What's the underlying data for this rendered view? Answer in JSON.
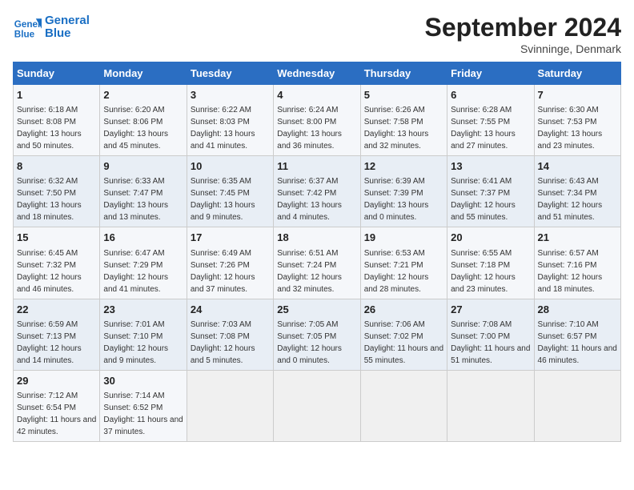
{
  "header": {
    "logo_line1": "General",
    "logo_line2": "Blue",
    "month": "September 2024",
    "location": "Svinninge, Denmark"
  },
  "days_of_week": [
    "Sunday",
    "Monday",
    "Tuesday",
    "Wednesday",
    "Thursday",
    "Friday",
    "Saturday"
  ],
  "weeks": [
    [
      {
        "day": 1,
        "sunrise": "6:18 AM",
        "sunset": "8:08 PM",
        "daylight": "13 hours and 50 minutes."
      },
      {
        "day": 2,
        "sunrise": "6:20 AM",
        "sunset": "8:06 PM",
        "daylight": "13 hours and 45 minutes."
      },
      {
        "day": 3,
        "sunrise": "6:22 AM",
        "sunset": "8:03 PM",
        "daylight": "13 hours and 41 minutes."
      },
      {
        "day": 4,
        "sunrise": "6:24 AM",
        "sunset": "8:00 PM",
        "daylight": "13 hours and 36 minutes."
      },
      {
        "day": 5,
        "sunrise": "6:26 AM",
        "sunset": "7:58 PM",
        "daylight": "13 hours and 32 minutes."
      },
      {
        "day": 6,
        "sunrise": "6:28 AM",
        "sunset": "7:55 PM",
        "daylight": "13 hours and 27 minutes."
      },
      {
        "day": 7,
        "sunrise": "6:30 AM",
        "sunset": "7:53 PM",
        "daylight": "13 hours and 23 minutes."
      }
    ],
    [
      {
        "day": 8,
        "sunrise": "6:32 AM",
        "sunset": "7:50 PM",
        "daylight": "13 hours and 18 minutes."
      },
      {
        "day": 9,
        "sunrise": "6:33 AM",
        "sunset": "7:47 PM",
        "daylight": "13 hours and 13 minutes."
      },
      {
        "day": 10,
        "sunrise": "6:35 AM",
        "sunset": "7:45 PM",
        "daylight": "13 hours and 9 minutes."
      },
      {
        "day": 11,
        "sunrise": "6:37 AM",
        "sunset": "7:42 PM",
        "daylight": "13 hours and 4 minutes."
      },
      {
        "day": 12,
        "sunrise": "6:39 AM",
        "sunset": "7:39 PM",
        "daylight": "13 hours and 0 minutes."
      },
      {
        "day": 13,
        "sunrise": "6:41 AM",
        "sunset": "7:37 PM",
        "daylight": "12 hours and 55 minutes."
      },
      {
        "day": 14,
        "sunrise": "6:43 AM",
        "sunset": "7:34 PM",
        "daylight": "12 hours and 51 minutes."
      }
    ],
    [
      {
        "day": 15,
        "sunrise": "6:45 AM",
        "sunset": "7:32 PM",
        "daylight": "12 hours and 46 minutes."
      },
      {
        "day": 16,
        "sunrise": "6:47 AM",
        "sunset": "7:29 PM",
        "daylight": "12 hours and 41 minutes."
      },
      {
        "day": 17,
        "sunrise": "6:49 AM",
        "sunset": "7:26 PM",
        "daylight": "12 hours and 37 minutes."
      },
      {
        "day": 18,
        "sunrise": "6:51 AM",
        "sunset": "7:24 PM",
        "daylight": "12 hours and 32 minutes."
      },
      {
        "day": 19,
        "sunrise": "6:53 AM",
        "sunset": "7:21 PM",
        "daylight": "12 hours and 28 minutes."
      },
      {
        "day": 20,
        "sunrise": "6:55 AM",
        "sunset": "7:18 PM",
        "daylight": "12 hours and 23 minutes."
      },
      {
        "day": 21,
        "sunrise": "6:57 AM",
        "sunset": "7:16 PM",
        "daylight": "12 hours and 18 minutes."
      }
    ],
    [
      {
        "day": 22,
        "sunrise": "6:59 AM",
        "sunset": "7:13 PM",
        "daylight": "12 hours and 14 minutes."
      },
      {
        "day": 23,
        "sunrise": "7:01 AM",
        "sunset": "7:10 PM",
        "daylight": "12 hours and 9 minutes."
      },
      {
        "day": 24,
        "sunrise": "7:03 AM",
        "sunset": "7:08 PM",
        "daylight": "12 hours and 5 minutes."
      },
      {
        "day": 25,
        "sunrise": "7:05 AM",
        "sunset": "7:05 PM",
        "daylight": "12 hours and 0 minutes."
      },
      {
        "day": 26,
        "sunrise": "7:06 AM",
        "sunset": "7:02 PM",
        "daylight": "11 hours and 55 minutes."
      },
      {
        "day": 27,
        "sunrise": "7:08 AM",
        "sunset": "7:00 PM",
        "daylight": "11 hours and 51 minutes."
      },
      {
        "day": 28,
        "sunrise": "7:10 AM",
        "sunset": "6:57 PM",
        "daylight": "11 hours and 46 minutes."
      }
    ],
    [
      {
        "day": 29,
        "sunrise": "7:12 AM",
        "sunset": "6:54 PM",
        "daylight": "11 hours and 42 minutes."
      },
      {
        "day": 30,
        "sunrise": "7:14 AM",
        "sunset": "6:52 PM",
        "daylight": "11 hours and 37 minutes."
      },
      null,
      null,
      null,
      null,
      null
    ]
  ]
}
